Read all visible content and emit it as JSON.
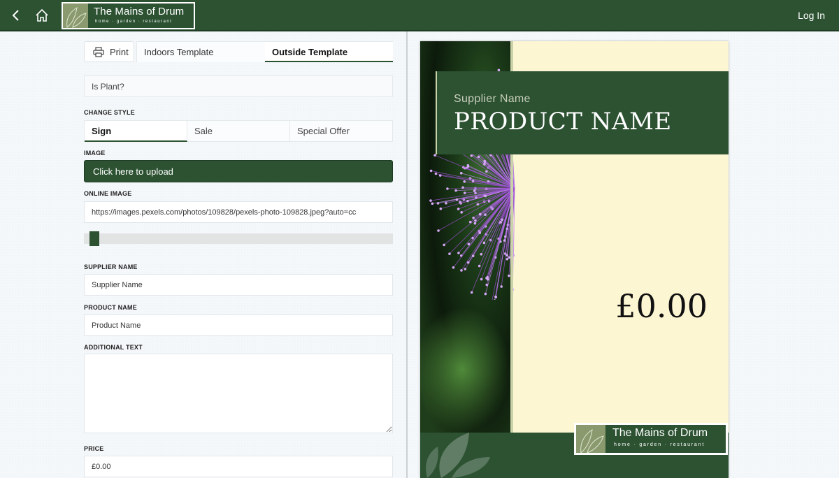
{
  "header": {
    "logo_title": "The Mains of Drum",
    "logo_subtitle": "home · garden · restaurant",
    "login_label": "Log In"
  },
  "toolbar": {
    "print_label": "Print",
    "tabs": [
      {
        "label": "Indoors Template"
      },
      {
        "label": "Outside Template"
      }
    ],
    "active_tab": "Outside Template"
  },
  "form": {
    "is_plant_label": "Is Plant?",
    "change_style_label": "CHANGE STYLE",
    "styles": [
      {
        "label": "Sign"
      },
      {
        "label": "Sale"
      },
      {
        "label": "Special Offer"
      }
    ],
    "active_style": "Sign",
    "image_label": "IMAGE",
    "upload_label": "Click here to upload",
    "online_image_label": "ONLINE IMAGE",
    "online_image_value": "https://images.pexels.com/photos/109828/pexels-photo-109828.jpeg?auto=cc",
    "slider_value": 0,
    "supplier_name_label": "SUPPLIER NAME",
    "supplier_name_value": "Supplier Name",
    "product_name_label": "PRODUCT NAME",
    "product_name_value": "Product Name",
    "additional_text_label": "ADDITIONAL TEXT",
    "additional_text_value": "",
    "price_label": "PRICE",
    "price_value": "£0.00"
  },
  "preview": {
    "supplier_name": "Supplier Name",
    "product_name": "PRODUCT NAME",
    "price": "£0.00",
    "logo_title": "The Mains of Drum",
    "logo_subtitle": "home · garden · restaurant"
  },
  "colors": {
    "brand_green": "#2c5232",
    "card_cream": "#fdf6d3",
    "flower_purple": "#9b4fd0"
  }
}
